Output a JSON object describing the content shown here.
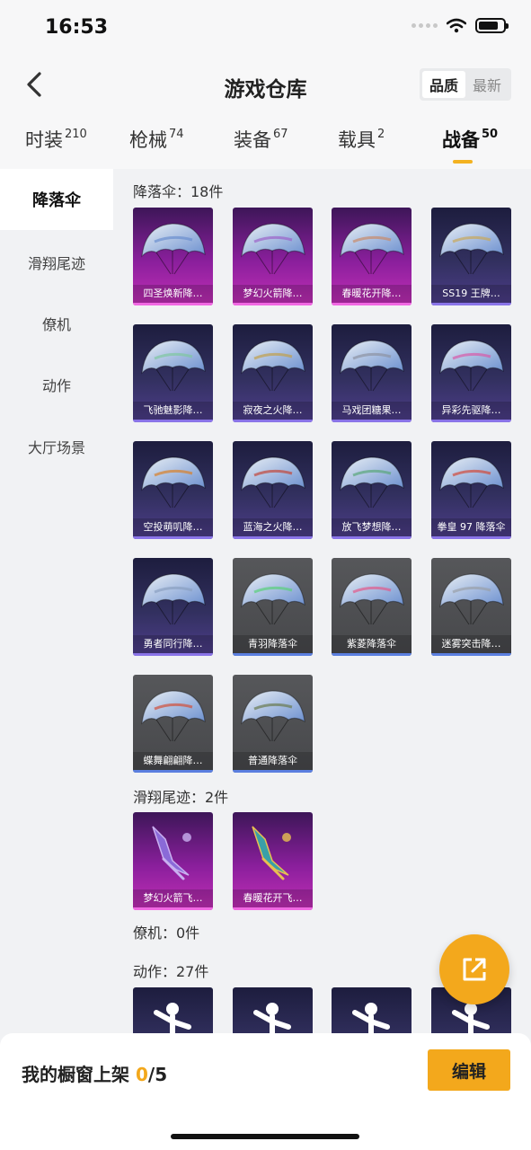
{
  "status": {
    "time": "16:53"
  },
  "header": {
    "title": "游戏仓库",
    "sort_options": [
      "品质",
      "最新"
    ],
    "sort_selected": "品质"
  },
  "tabs": [
    {
      "label": "时装",
      "count": "210"
    },
    {
      "label": "枪械",
      "count": "74"
    },
    {
      "label": "装备",
      "count": "67"
    },
    {
      "label": "载具",
      "count": "2"
    },
    {
      "label": "战备",
      "count": "50",
      "active": true
    }
  ],
  "sidebar": {
    "items": [
      {
        "label": "降落伞",
        "active": true
      },
      {
        "label": "滑翔尾迹"
      },
      {
        "label": "僚机"
      },
      {
        "label": "动作"
      },
      {
        "label": "大厅场景"
      }
    ]
  },
  "sections": {
    "parachute": {
      "title": "降落伞：18件",
      "items": [
        {
          "name": "四圣焕新降…",
          "rarity": "pink",
          "icon": "parachute-icon",
          "colors": [
            "#e9eff5",
            "#6b8fcf"
          ]
        },
        {
          "name": "梦幻火箭降…",
          "rarity": "pink",
          "icon": "parachute-icon",
          "colors": [
            "#e6d6ef",
            "#9c63c9"
          ]
        },
        {
          "name": "春暖花开降…",
          "rarity": "pink",
          "icon": "parachute-icon",
          "colors": [
            "#efe6dc",
            "#c98a6a"
          ]
        },
        {
          "name": "SS19 王牌…",
          "rarity": "purple",
          "icon": "parachute-icon",
          "colors": [
            "#2d2a22",
            "#c9a85a"
          ]
        },
        {
          "name": "飞驰魅影降…",
          "rarity": "purple",
          "icon": "parachute-icon",
          "colors": [
            "#d9efe0",
            "#7fc8a0"
          ]
        },
        {
          "name": "寂夜之火降…",
          "rarity": "purple",
          "icon": "parachute-icon",
          "colors": [
            "#2b2a20",
            "#c2a04a"
          ]
        },
        {
          "name": "马戏团糖果…",
          "rarity": "purple",
          "icon": "parachute-icon",
          "colors": [
            "#d8dbe2",
            "#8d93a3"
          ]
        },
        {
          "name": "异彩先驱降…",
          "rarity": "purple",
          "icon": "parachute-icon",
          "colors": [
            "#f2dc6a",
            "#d85aa8"
          ]
        },
        {
          "name": "空投萌叽降…",
          "rarity": "purple",
          "icon": "parachute-icon",
          "colors": [
            "#f3c23a",
            "#d8802a"
          ]
        },
        {
          "name": "蓝海之火降…",
          "rarity": "purple",
          "icon": "parachute-icon",
          "colors": [
            "#2a2b32",
            "#c2473a"
          ]
        },
        {
          "name": "放飞梦想降…",
          "rarity": "purple",
          "icon": "parachute-icon",
          "colors": [
            "#e2eef2",
            "#5aa67a"
          ]
        },
        {
          "name": "拳皇 97 降落伞",
          "rarity": "purple",
          "icon": "parachute-icon",
          "colors": [
            "#3a2224",
            "#d24a3a"
          ]
        },
        {
          "name": "勇者同行降…",
          "rarity": "purple",
          "icon": "parachute-icon",
          "colors": [
            "#1c2430",
            "#8aa0c0"
          ]
        },
        {
          "name": "青羽降落伞",
          "rarity": "gray",
          "icon": "parachute-icon",
          "colors": [
            "#2c3a35",
            "#5ad07a"
          ]
        },
        {
          "name": "紫菱降落伞",
          "rarity": "gray",
          "icon": "parachute-icon",
          "colors": [
            "#4a2a5a",
            "#e25a8a"
          ]
        },
        {
          "name": "迷雾突击降…",
          "rarity": "gray",
          "icon": "parachute-icon",
          "colors": [
            "#2c2e32",
            "#9aa0a8"
          ]
        },
        {
          "name": "蝶舞翩翩降…",
          "rarity": "gray",
          "icon": "parachute-icon",
          "colors": [
            "#e8a06a",
            "#d2503a"
          ]
        },
        {
          "name": "普通降落伞",
          "rarity": "gray",
          "icon": "parachute-icon",
          "colors": [
            "#3a4430",
            "#6a7a50"
          ]
        }
      ]
    },
    "trail": {
      "title": "滑翔尾迹：2件",
      "items": [
        {
          "name": "梦幻火箭飞…",
          "rarity": "pink",
          "icon": "glider-trail-icon",
          "colors": [
            "#8a6ad8",
            "#c9b0f0"
          ]
        },
        {
          "name": "春暖花开飞…",
          "rarity": "pink",
          "icon": "glider-trail-icon",
          "colors": [
            "#3aa0a8",
            "#e8c050"
          ]
        }
      ]
    },
    "wingman": {
      "title": "僚机：0件"
    },
    "emote": {
      "title": "动作：27件",
      "items": [
        {
          "rarity": "purple",
          "icon": "dance-pose-icon"
        },
        {
          "rarity": "purple",
          "icon": "dance-pose-icon"
        },
        {
          "rarity": "purple",
          "icon": "dance-pose-icon"
        },
        {
          "rarity": "purple",
          "icon": "dance-pose-icon"
        }
      ]
    }
  },
  "bottom_bar": {
    "label": "我的橱窗上架",
    "current": "0",
    "total": "/5",
    "edit_label": "编辑"
  },
  "accent_color": "#f3a81c"
}
